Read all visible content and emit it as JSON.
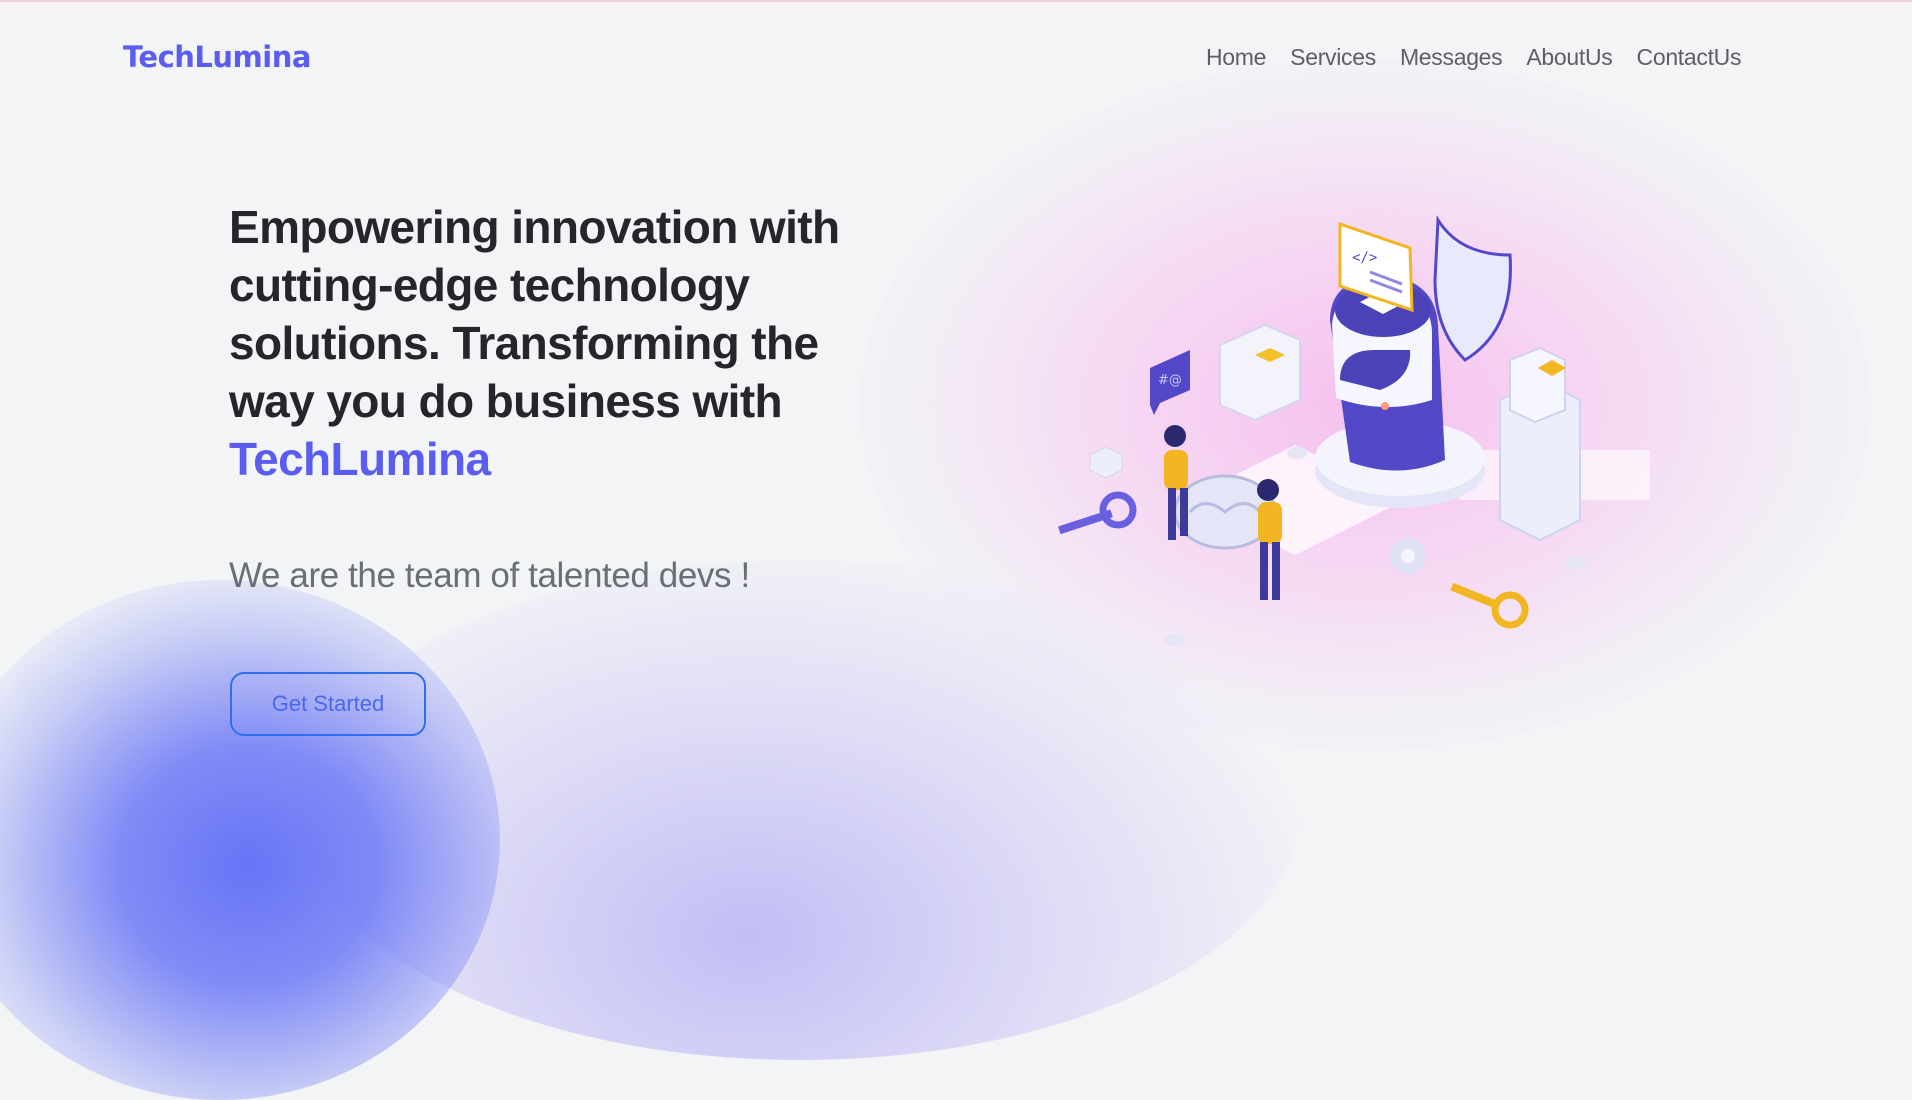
{
  "brand": "TechLumina",
  "nav": {
    "items": [
      {
        "label": "Home"
      },
      {
        "label": "Services"
      },
      {
        "label": "Messages"
      },
      {
        "label": "AboutUs"
      },
      {
        "label": "ContactUs"
      }
    ]
  },
  "hero": {
    "title_lines": [
      "Empowering innovation with",
      "cutting-edge technology",
      "solutions. Transforming the",
      "way you do business with"
    ],
    "title_brand": "TechLumina",
    "subtitle": "We are the team of talented devs !",
    "cta_label": "Get Started"
  },
  "colors": {
    "accent": "#5a5df0",
    "button_border": "#2d6ff0",
    "heading": "#24262b",
    "background": "#f2f4f6"
  },
  "icons": [
    "tech-illustration"
  ]
}
